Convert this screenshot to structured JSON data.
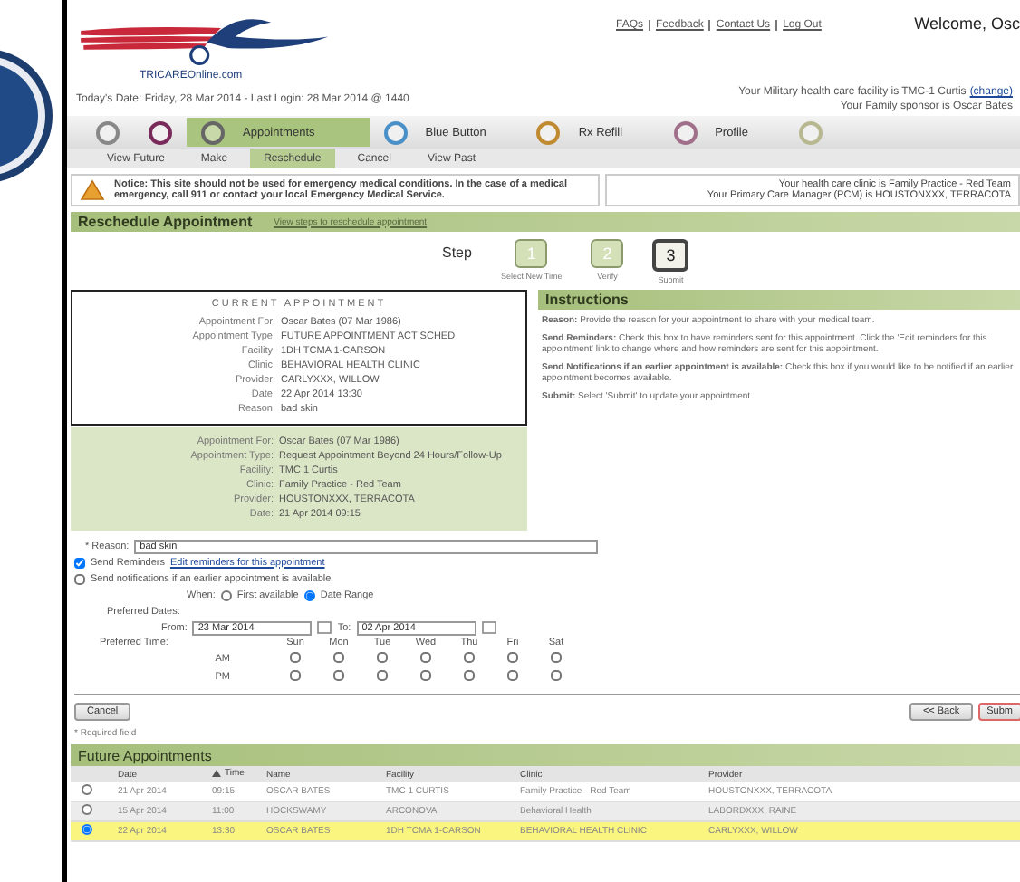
{
  "header": {
    "logo_text": "TRICAREOnline.com",
    "top_links": [
      "FAQs",
      "Feedback",
      "Contact Us",
      "Log Out"
    ],
    "welcome": "Welcome, Osc",
    "date_line": "Today's Date: Friday, 28 Mar 2014 - Last Login: 28 Mar 2014 @ 1440",
    "facility_line": "Your Military health care facility is TMC-1 Curtis",
    "facility_link": "(change)",
    "sponsor_line": "Your Family sponsor is Oscar Bates"
  },
  "nav": [
    {
      "selected": false
    },
    {
      "selected": false
    },
    {
      "label": "Appointments",
      "selected": true
    },
    {
      "label": "Blue Button",
      "selected": false
    },
    {
      "label": "Rx Refill",
      "selected": false
    },
    {
      "label": "Profile",
      "selected": false
    },
    {
      "selected": false
    }
  ],
  "subtabs": [
    {
      "label": "View Future",
      "selected": false
    },
    {
      "label": "Make",
      "selected": false
    },
    {
      "label": "Reschedule",
      "selected": true
    },
    {
      "label": "Cancel",
      "selected": false
    },
    {
      "label": "View Past",
      "selected": false
    }
  ],
  "notice": "Notice: This site should not be used for emergency medical conditions. In the case of a medical emergency, call 911 or contact your local Emergency Medical Service.",
  "clinic_lines": [
    "Your health care clinic is Family Practice - Red Team",
    "Your Primary Care Manager (PCM) is HOUSTONXXX, TERRACOTA"
  ],
  "section": {
    "title": "Reschedule Appointment",
    "link": "View steps to reschedule appointment"
  },
  "steps": {
    "label": "Step",
    "items": [
      {
        "number": "1",
        "caption": "Select New Time",
        "selected": false
      },
      {
        "number": "2",
        "caption": "Verify",
        "selected": false
      },
      {
        "number": "3",
        "caption": "Submit",
        "selected": true
      }
    ]
  },
  "current_appointment": {
    "title": "CURRENT APPOINTMENT",
    "fields": [
      {
        "label": "Appointment For:",
        "value": "Oscar Bates (07 Mar 1986)"
      },
      {
        "label": "Appointment Type:",
        "value": "FUTURE APPOINTMENT ACT SCHED"
      },
      {
        "label": "Facility:",
        "value": "1DH TCMA 1-CARSON"
      },
      {
        "label": "Clinic:",
        "value": "BEHAVIORAL HEALTH CLINIC"
      },
      {
        "label": "Provider:",
        "value": "CARLYXXX, WILLOW"
      },
      {
        "label": "Date:",
        "value": "22 Apr 2014 13:30"
      },
      {
        "label": "Reason:",
        "value": "bad skin"
      }
    ]
  },
  "new_appointment": {
    "fields": [
      {
        "label": "Appointment For:",
        "value": "Oscar Bates (07 Mar 1986)"
      },
      {
        "label": "Appointment Type:",
        "value": "Request Appointment Beyond 24 Hours/Follow-Up"
      },
      {
        "label": "Facility:",
        "value": "TMC 1 Curtis"
      },
      {
        "label": "Clinic:",
        "value": "Family Practice - Red Team"
      },
      {
        "label": "Provider:",
        "value": "HOUSTONXXX, TERRACOTA"
      },
      {
        "label": "Date:",
        "value": "21 Apr 2014 09:15"
      }
    ]
  },
  "instructions": {
    "title": "Instructions",
    "paragraphs": [
      "**Reason:** Provide the reason for your appointment to share with your medical team.",
      "**Send Reminders:** Check this box to have reminders sent for this appointment. Click the 'Edit reminders for this appointment' link to change where and how reminders are sent for this appointment.",
      "**Send Notifications if an earlier appointment is available:** Check this box if you would like to be notified if an earlier appointment becomes available.",
      "**Submit:** Select 'Submit' to update your appointment."
    ]
  },
  "form": {
    "reason_label": "* Reason:",
    "reason_value": "bad skin",
    "reminders": {
      "label": "Send Reminders",
      "link": "Edit reminders for this appointment",
      "checked": true
    },
    "notify": {
      "label": "Send notifications if an earlier appointment is available",
      "checked": false
    },
    "when_label": "When:",
    "when_options": [
      {
        "label": "First available",
        "selected": false
      },
      {
        "label": "Date Range",
        "selected": true
      }
    ],
    "dates_label": "Preferred Dates:",
    "from_label": "From:",
    "from_value": "23 Mar 2014",
    "to_label": "To:",
    "to_value": "02 Apr 2014",
    "time_label": "Preferred Time:",
    "days": [
      "Sun",
      "Mon",
      "Tue",
      "Wed",
      "Thu",
      "Fri",
      "Sat"
    ],
    "times": [
      {
        "label": "AM",
        "checked": [
          false,
          false,
          false,
          false,
          false,
          false,
          false
        ]
      },
      {
        "label": "PM",
        "checked": [
          false,
          false,
          false,
          false,
          false,
          false,
          false
        ]
      }
    ]
  },
  "buttons": {
    "cancel": "Cancel",
    "back": "<< Back",
    "submit": "Subm"
  },
  "required_note": "* Required field",
  "future": {
    "title": "Future Appointments",
    "columns": [
      {
        "label": "Date",
        "sorted": false
      },
      {
        "label": "Time",
        "sorted": true
      },
      {
        "label": "Name",
        "sorted": false
      },
      {
        "label": "Facility",
        "sorted": false
      },
      {
        "label": "Clinic",
        "sorted": false
      },
      {
        "label": "Provider",
        "sorted": false
      }
    ],
    "rows": [
      {
        "selected": false,
        "cells": [
          "21 Apr 2014",
          "09:15",
          "OSCAR BATES",
          "TMC 1 CURTIS",
          "Family Practice - Red Team",
          "HOUSTONXXX, TERRACOTA"
        ]
      },
      {
        "selected": false,
        "cells": [
          "15 Apr 2014",
          "11:00",
          "HOCKSWAMY",
          "ARCONOVA",
          "Behavioral Health",
          "LABORDXXX, RAINE"
        ]
      },
      {
        "selected": true,
        "cells": [
          "22 Apr 2014",
          "13:30",
          "OSCAR BATES",
          "1DH TCMA 1-CARSON",
          "BEHAVIORAL HEALTH CLINIC",
          "CARLYXXX, WILLOW"
        ]
      }
    ]
  }
}
